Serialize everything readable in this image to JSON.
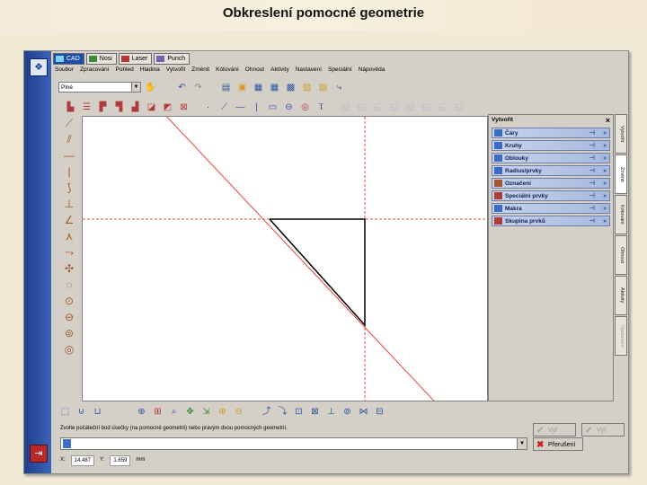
{
  "slide": {
    "title": "Obkreslení pomocné geometrie"
  },
  "app": {
    "tabs": [
      {
        "label": "CAD",
        "active": true
      },
      {
        "label": "Nosi",
        "active": false
      },
      {
        "label": "Laser",
        "active": false
      },
      {
        "label": "Punch",
        "active": false
      }
    ],
    "menu": [
      "Soubor",
      "Zpracování",
      "Pohled",
      "Hladina",
      "Vytvořit",
      "Změnit",
      "Kótování",
      "Ohnout",
      "Aktivity",
      "Nastavení",
      "Speciální",
      "Nápověda"
    ],
    "layer_combo": "Plné",
    "panel": {
      "title": "Vytvořit",
      "close": "×",
      "items": [
        {
          "label": "Čáry",
          "icon_color": "#3b6cc4"
        },
        {
          "label": "Kruhy",
          "icon_color": "#3b6cc4"
        },
        {
          "label": "Oblouky",
          "icon_color": "#3b6cc4"
        },
        {
          "label": "Radius/prvky",
          "icon_color": "#3b6cc4"
        },
        {
          "label": "Označení",
          "icon_color": "#a0572a"
        },
        {
          "label": "Speciální prvky",
          "icon_color": "#b23a3a"
        },
        {
          "label": "Makra",
          "icon_color": "#3b6cc4"
        },
        {
          "label": "Skupina prvků",
          "icon_color": "#b23a3a"
        }
      ],
      "pin_glyph": "⊣",
      "expand_glyph": "»"
    },
    "side_tabs": [
      "Vytvořit",
      "Změnit",
      "Kótování",
      "Ohnout",
      "Aktivity",
      "Nastavení"
    ],
    "prompt": "Zvolte počáteční bod úsečky (na pomocné geometrii) nebo pravým dvou pomocných geometrií.",
    "buttons": {
      "ok": "Výř",
      "cancel_disabled": "Výř",
      "interrupt": "Přerušení"
    },
    "status": {
      "x_label": "X:",
      "x_value": "14.487",
      "y_label": "Y:",
      "y_value": "1.659",
      "unit": "mm"
    },
    "colors": {
      "construction_line": "#e8453c",
      "geometry_line": "#000000",
      "accent_blue": "#1c4ea8"
    }
  }
}
